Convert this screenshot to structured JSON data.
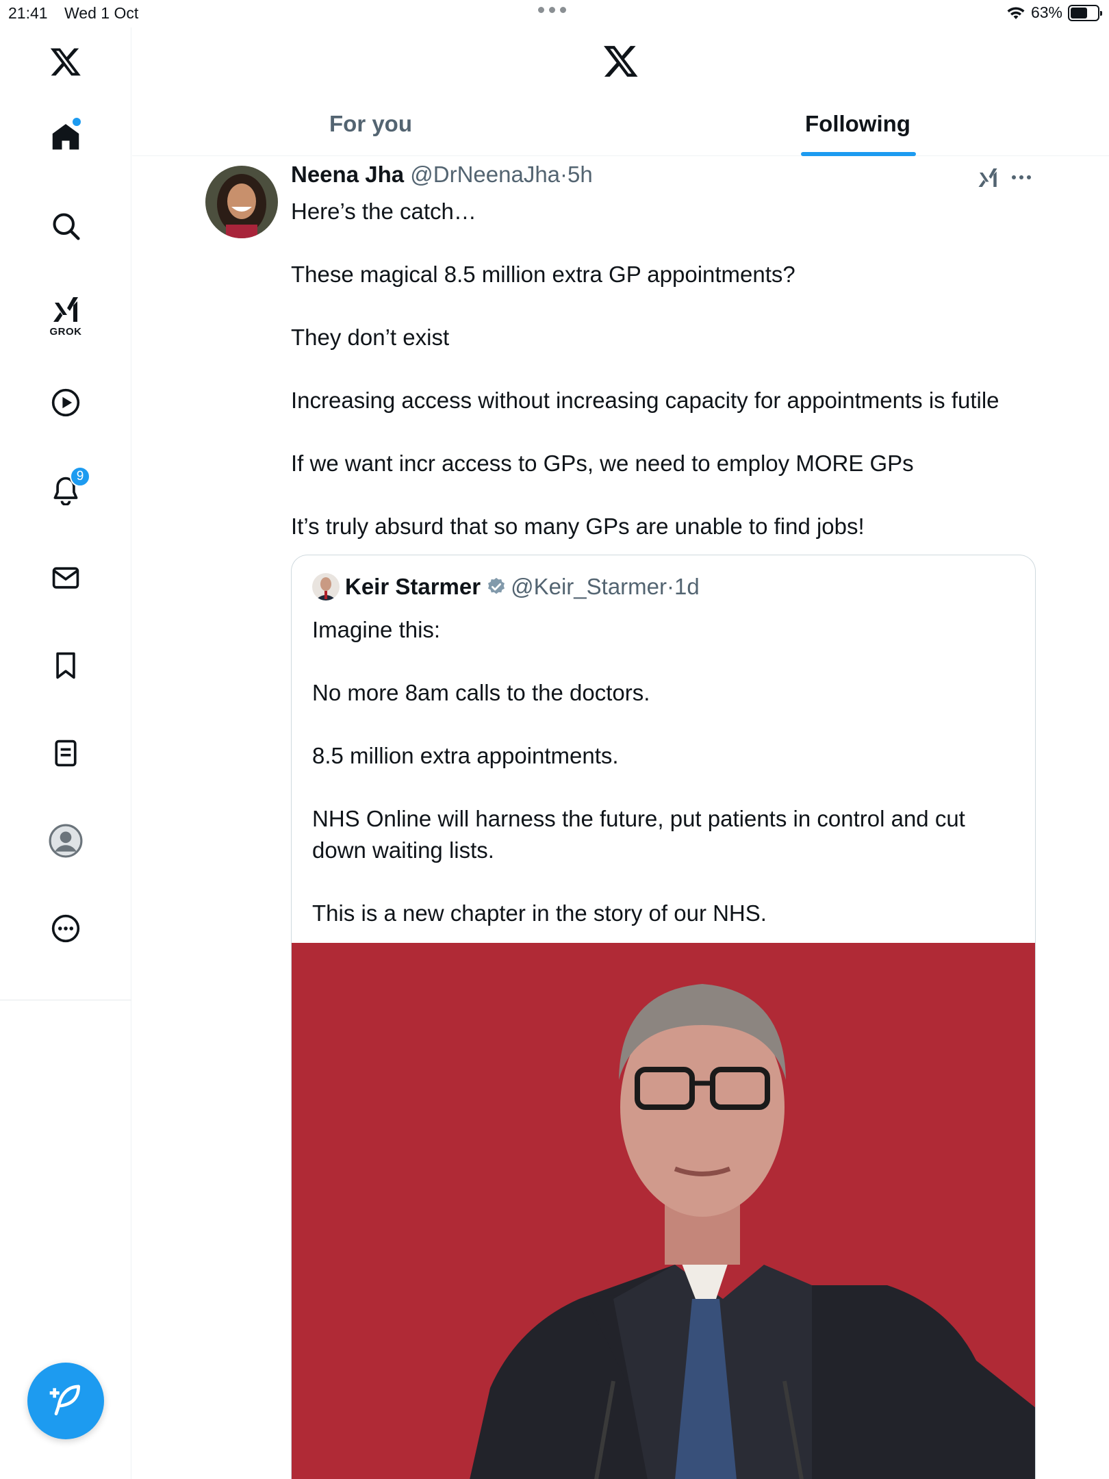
{
  "status_bar": {
    "time": "21:41",
    "date": "Wed 1 Oct",
    "battery": "63%"
  },
  "sidebar": {
    "items": [
      {
        "name": "home",
        "icon": "home-icon"
      },
      {
        "name": "search",
        "icon": "search-icon"
      },
      {
        "name": "grok",
        "icon": "grok-icon",
        "label": "GROK"
      },
      {
        "name": "video",
        "icon": "play-icon"
      },
      {
        "name": "notifications",
        "icon": "bell-icon",
        "badge": "9"
      },
      {
        "name": "messages",
        "icon": "mail-icon"
      },
      {
        "name": "bookmarks",
        "icon": "bookmark-icon"
      },
      {
        "name": "lists",
        "icon": "list-icon"
      },
      {
        "name": "profile",
        "icon": "profile-icon"
      },
      {
        "name": "more",
        "icon": "more-circle-icon"
      }
    ],
    "compose_icon": "compose-feather-icon"
  },
  "header": {
    "logo_icon": "x-logo-icon",
    "tabs": [
      {
        "label": "For you",
        "active": false
      },
      {
        "label": "Following",
        "active": true
      }
    ]
  },
  "tweet": {
    "author_name": "Neena Jha",
    "handle": "@DrNeenaJha",
    "separator": "·",
    "time": "5h",
    "paragraphs": [
      "Here’s the catch…",
      "These magical 8.5 million extra GP appointments?",
      "They don’t exist",
      "Increasing access without increasing capacity for appointments is futile",
      "If we want incr access to GPs, we need to employ MORE GPs",
      "It’s truly absurd that so many GPs are unable to find jobs!"
    ],
    "quote": {
      "author_name": "Keir Starmer",
      "handle": "@Keir_Starmer",
      "separator": "·",
      "time": "1d",
      "verified": true,
      "paragraphs": [
        "Imagine this:",
        "No more 8am calls to the doctors.",
        "8.5 million extra appointments.",
        "NHS Online will harness the future, put patients in control and cut down waiting lists.",
        "This is a new chapter in the story of our NHS."
      ]
    }
  },
  "colors": {
    "accent": "#1d9bf0",
    "text": "#0f1419",
    "secondary": "#536471",
    "media_bg": "#b02a36"
  }
}
